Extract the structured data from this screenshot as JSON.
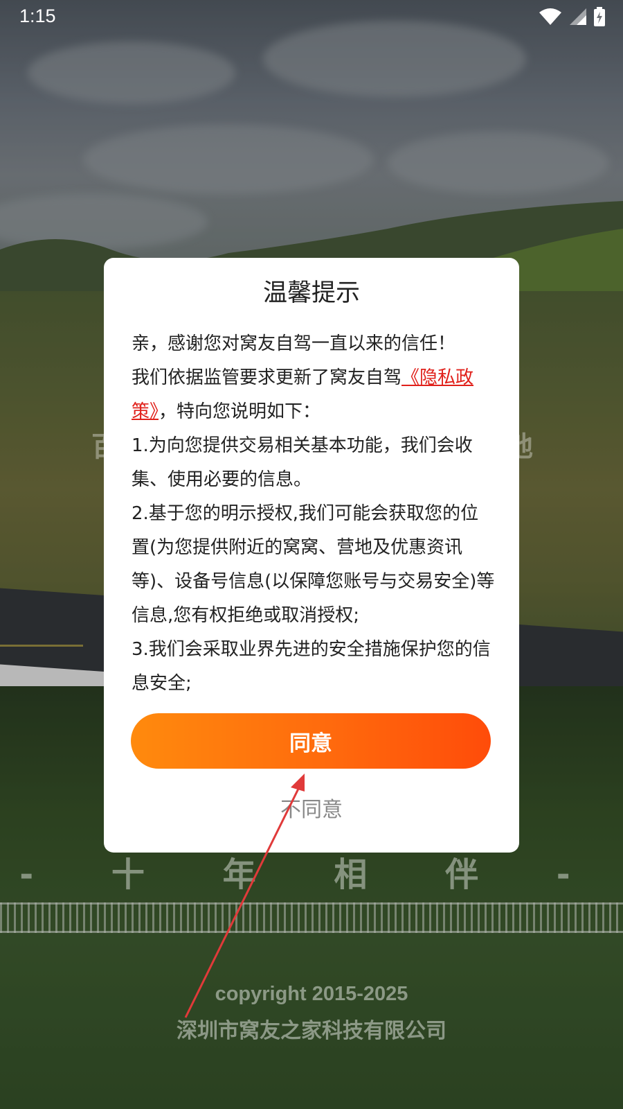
{
  "status_bar": {
    "time": "1:15",
    "icons": [
      "wifi-icon",
      "signal-icon",
      "battery-charging-icon"
    ]
  },
  "background": {
    "left_char": "百",
    "right_char": "地",
    "decade_text": "- 十 年 相 伴 -",
    "copyright": "copyright 2015-2025",
    "company": "深圳市窝友之家科技有限公司"
  },
  "dialog": {
    "title": "温馨提示",
    "line1": "亲，感谢您对窝友自驾一直以来的信任！",
    "line2_prefix": "我们依据监管要求更新了窝友自驾",
    "privacy_link": "《隐私政策》",
    "line2_suffix": "，特向您说明如下：",
    "item1": "1.为向您提供交易相关基本功能，我们会收集、使用必要的信息。",
    "item2": "2.基于您的明示授权,我们可能会获取您的位置(为您提供附近的窝窝、营地及优惠资讯等)、设备号信息(以保障您账号与交易安全)等信息,您有权拒绝或取消授权;",
    "item3": "3.我们会采取业界先进的安全措施保护您的信息安全;",
    "agree_label": "同意",
    "disagree_label": "不同意"
  },
  "colors": {
    "agree_gradient_start": "#ff8a0d",
    "agree_gradient_end": "#ff4c0a",
    "link": "#e0201a",
    "annotation_arrow": "#e03a3a"
  }
}
